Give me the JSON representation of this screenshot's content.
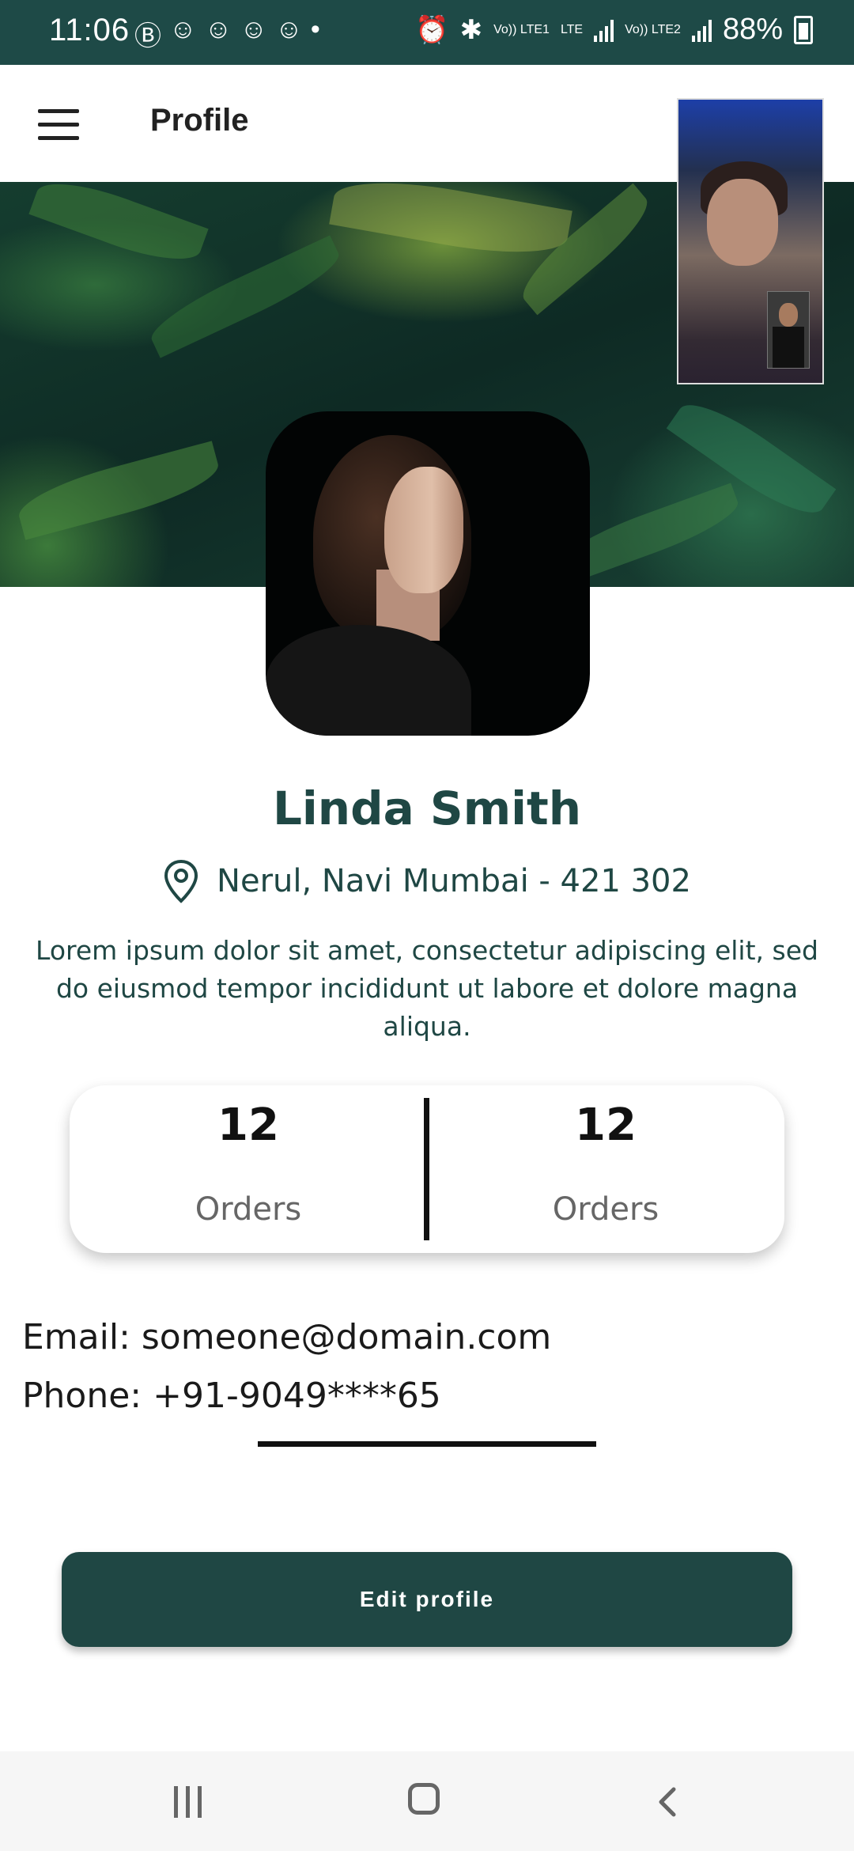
{
  "status_bar": {
    "time": "11:06",
    "battery": "88%",
    "net1": "Vo)) LTE1",
    "net2": "LTE",
    "net3": "Vo)) LTE2",
    "colors": {
      "background": "#1e4a47"
    }
  },
  "app_bar": {
    "title": "Profile"
  },
  "profile": {
    "name": "Linda Smith",
    "location": "Nerul, Navi Mumbai - 421 302",
    "bio": "Lorem ipsum dolor sit amet, consectetur adipiscing elit, sed do eiusmod tempor incididunt ut labore et dolore magna aliqua.",
    "stats": [
      {
        "value": "12",
        "label": "Orders"
      },
      {
        "value": "12",
        "label": "Orders"
      }
    ],
    "email": "Email: someone@domain.com",
    "phone": "Phone: +91-9049****65"
  },
  "actions": {
    "edit_label": "Edit profile"
  },
  "theme": {
    "primary": "#1f4744",
    "text_dark": "#111111",
    "muted": "#666666"
  },
  "icons": [
    "menu-icon",
    "location-pin-icon",
    "recent-apps-icon",
    "home-icon",
    "back-icon"
  ]
}
